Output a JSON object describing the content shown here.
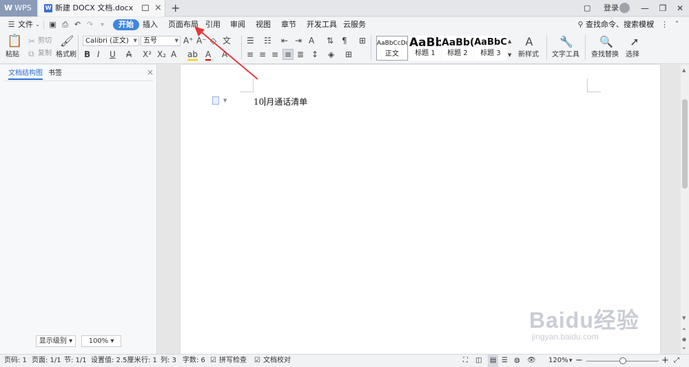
{
  "titlebar": {
    "app_tab": "WPS",
    "doc_tab": "新建 DOCX 文档.docx",
    "login": "登录"
  },
  "menu": {
    "file": "文件",
    "tabs": [
      "开始",
      "插入",
      "页面布局",
      "引用",
      "审阅",
      "视图",
      "章节",
      "开发工具",
      "云服务"
    ],
    "search": "查找命令、搜索模板"
  },
  "ribbon": {
    "paste": "粘贴",
    "cut": "剪切",
    "copy": "复制",
    "format_painter": "格式刷",
    "font_name": "Calibri (正文)",
    "font_size": "五号",
    "styles": [
      {
        "preview": "AaBbCcDd",
        "caption": "正文"
      },
      {
        "preview": "AaBb",
        "caption": "标题 1"
      },
      {
        "preview": "AaBb(",
        "caption": "标题 2"
      },
      {
        "preview": "AaBbC",
        "caption": "标题 3"
      }
    ],
    "new_style": "新样式",
    "text_tools": "文字工具",
    "find_replace": "查找替换",
    "select": "选择"
  },
  "left_pane": {
    "tab_outline": "文档结构图",
    "tab_bookmark": "书签",
    "show_level": "显示级别",
    "zoom": "100%"
  },
  "document": {
    "text_before_caret": "10",
    "text_after_caret": "月通话清单"
  },
  "status": {
    "page_num": "页码: 1",
    "pages": "页面: 1/1",
    "section": "节: 1/1",
    "setting": "设置值: 2.5厘米",
    "row": "行: 1",
    "col": "列: 3",
    "words": "字数: 6",
    "spell": "拼写检查",
    "proof": "文档校对",
    "zoom": "120%"
  },
  "watermark": {
    "logo": "Baidu经验",
    "url": "jingyan.baidu.com"
  },
  "colors": {
    "accent": "#3f86e0",
    "annotation_arrow": "#e5383b"
  }
}
